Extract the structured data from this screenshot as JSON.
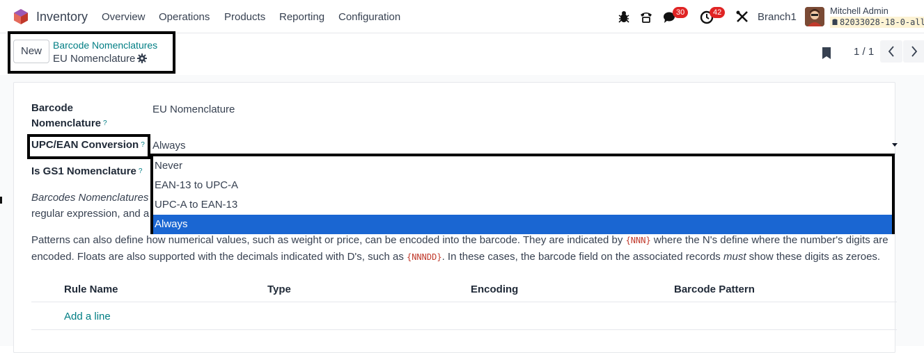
{
  "navbar": {
    "app_name": "Inventory",
    "menus": [
      "Overview",
      "Operations",
      "Products",
      "Reporting",
      "Configuration"
    ],
    "chat_badge": "30",
    "activity_badge": "42",
    "company": "Branch1",
    "user_name": "Mitchell Admin",
    "db_name": "82033028-18-0-all"
  },
  "breadcrumb": {
    "new_label": "New",
    "parent": "Barcode Nomenclatures",
    "current": "EU Nomenclature"
  },
  "pager": {
    "value": "1 / 1"
  },
  "form": {
    "name_label_1": "Barcode",
    "name_label_2": "Nomenclature",
    "name_value": "EU Nomenclature",
    "conversion_label": "UPC/EAN Conversion",
    "conversion_value": "Always",
    "gs1_label": "Is GS1 Nomenclature",
    "help_q": "?",
    "para1_start": "Barcodes Nomenclatures d",
    "para1_line2": "regular expression, and a b",
    "para2_a": "Patterns can also define how numerical values, such as weight or price, can be encoded into the barcode. They are indicated by ",
    "para2_code1": "{NNN}",
    "para2_b": " where the N's define where the number's digits are",
    "para3_a": "encoded. Floats are also supported with the decimals indicated with D's, such as ",
    "para3_code2": "{NNNDD}",
    "para3_b": ". In these cases, the barcode field on the associated records ",
    "para3_em": "must",
    "para3_c": " show these digits as zeroes."
  },
  "table": {
    "columns": [
      "Rule Name",
      "Type",
      "Encoding",
      "Barcode Pattern"
    ],
    "add_line": "Add a line"
  },
  "dropdown": {
    "options": [
      "Never",
      "EAN-13 to UPC-A",
      "UPC-A to EAN-13",
      "Always"
    ],
    "selected": "Always"
  },
  "colors": {
    "accent": "#017e84",
    "selected": "#1a66d2",
    "badge": "#e02424"
  }
}
